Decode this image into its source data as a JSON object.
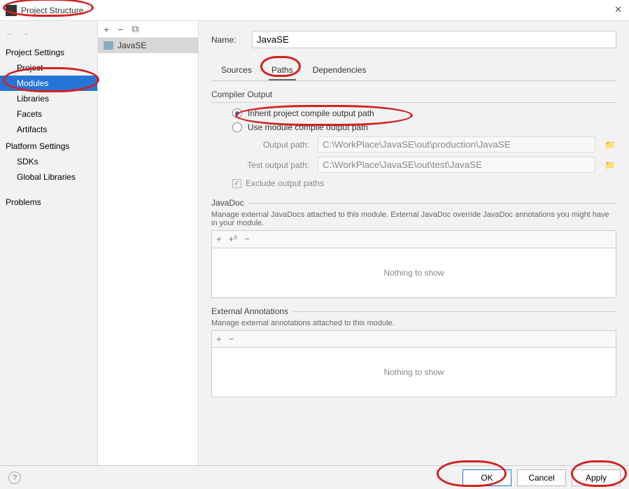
{
  "window": {
    "title": "Project Structure"
  },
  "sidebar": {
    "sections": {
      "project_settings": {
        "header": "Project Settings",
        "items": [
          "Project",
          "Modules",
          "Libraries",
          "Facets",
          "Artifacts"
        ],
        "selected": "Modules"
      },
      "platform_settings": {
        "header": "Platform Settings",
        "items": [
          "SDKs",
          "Global Libraries"
        ]
      },
      "other": {
        "items": [
          "Problems"
        ]
      }
    }
  },
  "modules": {
    "selected": "JavaSE"
  },
  "details": {
    "name_label": "Name:",
    "name_value": "JavaSE",
    "tabs": [
      "Sources",
      "Paths",
      "Dependencies"
    ],
    "active_tab": "Paths",
    "compiler_output": {
      "title": "Compiler Output",
      "option_inherit": "Inherit project compile output path",
      "option_module": "Use module compile output path",
      "selected": "inherit",
      "output_path_label": "Output path:",
      "output_path_value": "C:\\WorkPlace\\JavaSE\\out\\production\\JavaSE",
      "test_output_label": "Test output path:",
      "test_output_value": "C:\\WorkPlace\\JavaSE\\out\\test\\JavaSE",
      "exclude_label": "Exclude output paths",
      "exclude_checked": true
    },
    "javadoc": {
      "title": "JavaDoc",
      "desc": "Manage external JavaDocs attached to this module. External JavaDoc override JavaDoc annotations you might have in your module.",
      "empty": "Nothing to show"
    },
    "ext_annotations": {
      "title": "External Annotations",
      "desc": "Manage external annotations attached to this module.",
      "empty": "Nothing to show"
    }
  },
  "footer": {
    "ok": "OK",
    "cancel": "Cancel",
    "apply": "Apply"
  }
}
